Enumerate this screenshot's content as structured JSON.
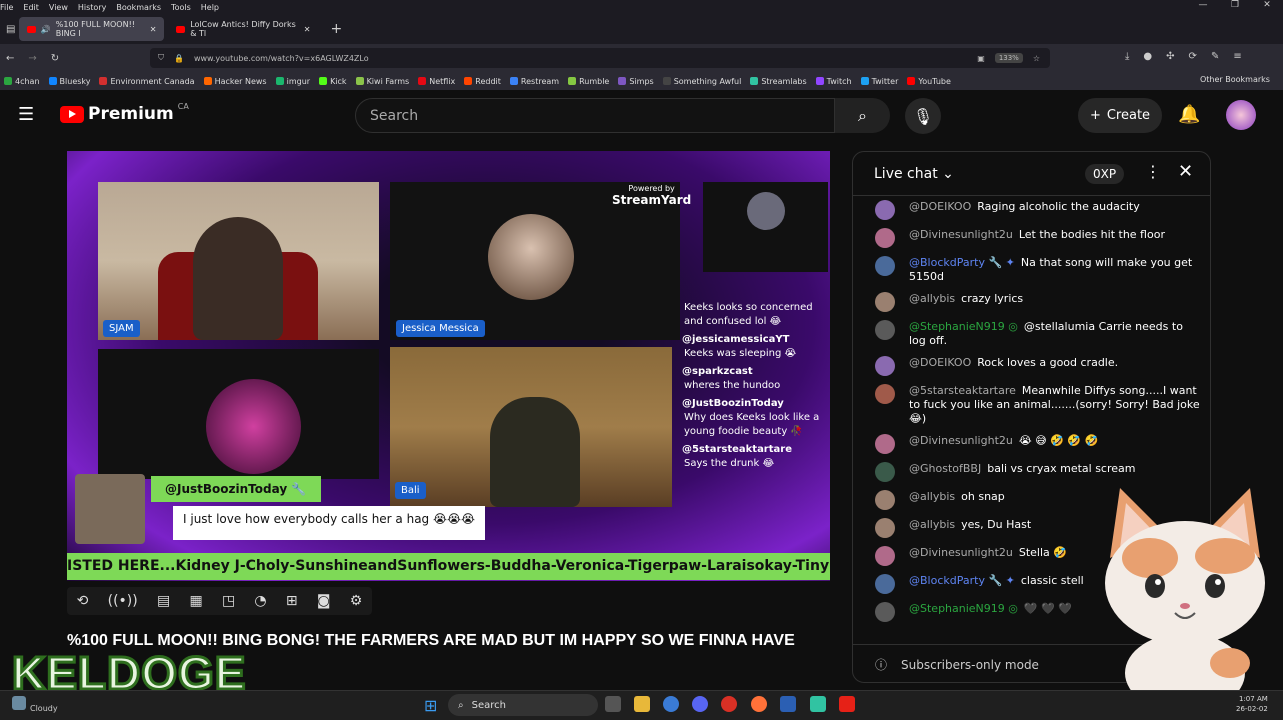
{
  "browser": {
    "menu": [
      "File",
      "Edit",
      "View",
      "History",
      "Bookmarks",
      "Tools",
      "Help"
    ],
    "tabs": [
      {
        "label": "%100 FULL MOON!! BING I"
      },
      {
        "label": "LolCow Antics! Diffy Dorks & Tl"
      }
    ],
    "url": "www.youtube.com/watch?v=x6AGLWZ4ZLo",
    "zoom": "133%",
    "bookmarks": [
      {
        "label": "4chan",
        "color": "#2ba640"
      },
      {
        "label": "Bluesky",
        "color": "#1185fe"
      },
      {
        "label": "Environment Canada",
        "color": "#d32f2f"
      },
      {
        "label": "Hacker News",
        "color": "#ff6600"
      },
      {
        "label": "imgur",
        "color": "#1bb76e"
      },
      {
        "label": "Kick",
        "color": "#53fc18"
      },
      {
        "label": "Kiwi Farms",
        "color": "#8bc34a"
      },
      {
        "label": "Netflix",
        "color": "#e50914"
      },
      {
        "label": "Reddit",
        "color": "#ff4500"
      },
      {
        "label": "Restream",
        "color": "#3b82f6"
      },
      {
        "label": "Rumble",
        "color": "#85c742"
      },
      {
        "label": "Simps",
        "color": "#7e57c2"
      },
      {
        "label": "Something Awful",
        "color": "#444"
      },
      {
        "label": "Streamlabs",
        "color": "#31c3a2"
      },
      {
        "label": "Twitch",
        "color": "#9146ff"
      },
      {
        "label": "Twitter",
        "color": "#1da1f2"
      },
      {
        "label": "YouTube",
        "color": "#ff0000"
      }
    ],
    "other_bookmarks": "Other Bookmarks"
  },
  "youtube": {
    "logo": "Premium",
    "region": "CA",
    "search_placeholder": "Search",
    "create_label": "Create"
  },
  "video": {
    "powered_by": "Powered by",
    "streamyard": "StreamYard",
    "cams": {
      "sjam": "SJAM",
      "jessica": "Jessica Messica",
      "bali": "Bali"
    },
    "overlay_chat": [
      {
        "user": "",
        "text": "Keeks looks so concerned and confused lol 😂"
      },
      {
        "user": "@jessicamessicaYT",
        "text": "Keeks was sleeping 😭"
      },
      {
        "user": "@sparkzcast",
        "text": "wheres the hundoo"
      },
      {
        "user": "@JustBoozinToday",
        "text": "Why does Keeks look like a young foodie beauty 🥀"
      },
      {
        "user": "@5starsteaktartare",
        "text": "Says the drunk 😂"
      }
    ],
    "comment_user": "@JustBoozinToday 🔧",
    "comment_text": "I just love how everybody calls her a hag 😭😭😭",
    "ticker": "ISTED HERE...Kidney J-Choly-SunshineandSunflowers-Buddha-Veronica-Tigerpaw-Laraisokay-TinyDance",
    "title": "%100 FULL MOON!! BING BONG! THE FARMERS ARE MAD BUT IM HAPPY SO WE FINNA HAVE"
  },
  "overlay_brand": "KELDOGE",
  "chat": {
    "header": "Live chat",
    "xp": "0XP",
    "messages": [
      {
        "author": "@DOEIKOO",
        "text": "Raging alcoholic the audacity",
        "type": "",
        "avatar": "#8a6ab0"
      },
      {
        "author": "@Divinesunlight2u",
        "text": "Let the bodies hit the floor",
        "type": "",
        "avatar": "#b06a8a"
      },
      {
        "author": "@BlockdParty 🔧 ✦",
        "text": "Na that song will make you get 5150d",
        "type": "mod",
        "avatar": "#4a6a9a"
      },
      {
        "author": "@allybis",
        "text": "crazy lyrics",
        "type": "",
        "avatar": "#9a8070"
      },
      {
        "author": "@StephanieN919 ◎",
        "text": "@stellalumia Carrie needs to log off.",
        "type": "mem",
        "avatar": "#5a5a5a"
      },
      {
        "author": "@DOEIKOO",
        "text": "Rock loves a good cradle.",
        "type": "",
        "avatar": "#8a6ab0"
      },
      {
        "author": "@5starsteaktartare",
        "text": "Meanwhile Diffys song.....I want to fuck you like an animal.......(sorry! Sorry! Bad joke 😂)",
        "type": "",
        "avatar": "#a05a4a"
      },
      {
        "author": "@Divinesunlight2u",
        "text": "😭 😅 🤣 🤣 🤣",
        "type": "",
        "avatar": "#b06a8a"
      },
      {
        "author": "@GhostofBBJ",
        "text": "bali vs cryax metal scream",
        "type": "",
        "avatar": "#3a5a4a"
      },
      {
        "author": "@allybis",
        "text": "oh snap",
        "type": "",
        "avatar": "#9a8070"
      },
      {
        "author": "@allybis",
        "text": "yes, Du Hast",
        "type": "",
        "avatar": "#9a8070"
      },
      {
        "author": "@Divinesunlight2u",
        "text": "Stella 🤣",
        "type": "",
        "avatar": "#b06a8a"
      },
      {
        "author": "@BlockdParty 🔧 ✦",
        "text": "classic stell",
        "type": "mod",
        "avatar": "#4a6a9a"
      },
      {
        "author": "@StephanieN919 ◎",
        "text": "🖤 🖤 🖤",
        "type": "mem",
        "avatar": "#5a5a5a"
      }
    ],
    "footer": "Subscribers-only mode"
  },
  "taskbar": {
    "weather": "Cloudy",
    "search": "Search",
    "time": "1:07 AM",
    "date": "26-02-02"
  }
}
